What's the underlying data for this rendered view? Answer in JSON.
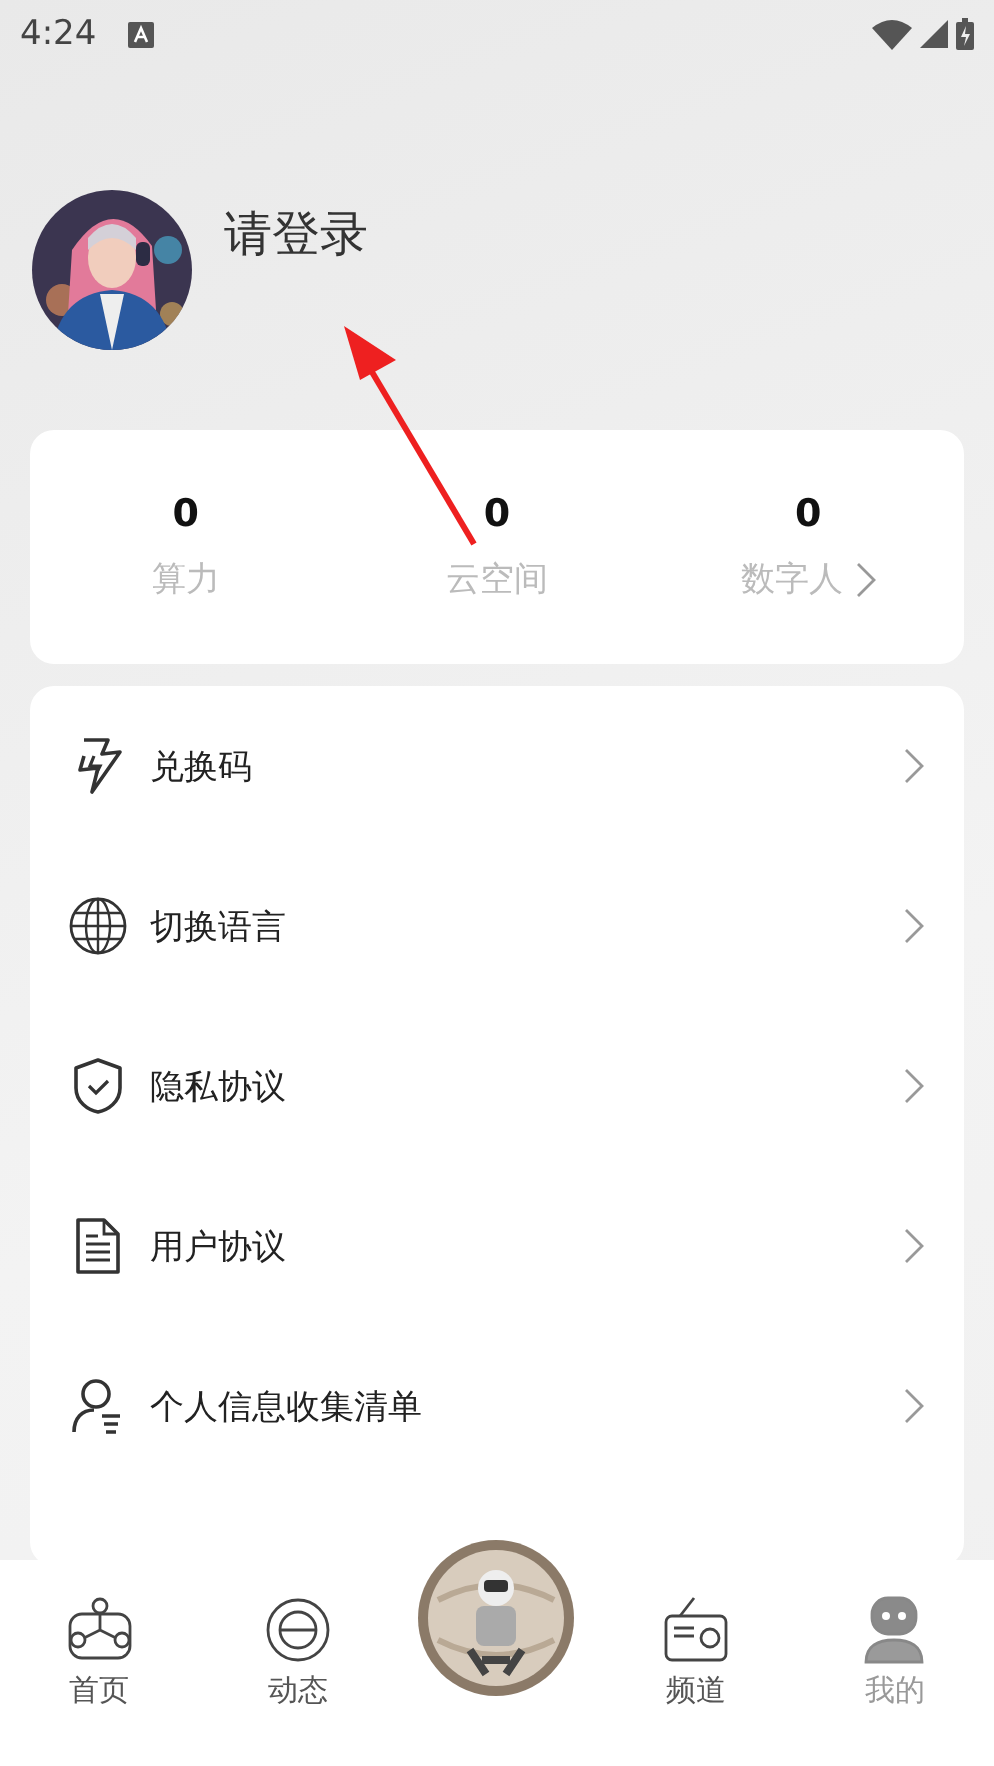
{
  "status_bar": {
    "time": "4:24"
  },
  "profile": {
    "login_prompt": "请登录"
  },
  "stats": [
    {
      "value": "0",
      "label": "算力",
      "has_arrow": false
    },
    {
      "value": "0",
      "label": "云空间",
      "has_arrow": false
    },
    {
      "value": "0",
      "label": "数字人",
      "has_arrow": true
    }
  ],
  "menu": [
    {
      "kind": "bolt",
      "label": "兑换码"
    },
    {
      "kind": "globe",
      "label": "切换语言"
    },
    {
      "kind": "shield",
      "label": "隐私协议"
    },
    {
      "kind": "document",
      "label": "用户协议"
    },
    {
      "kind": "person",
      "label": "个人信息收集清单"
    }
  ],
  "nav": [
    {
      "kind": "home",
      "label": "首页",
      "selected": false
    },
    {
      "kind": "planet",
      "label": "动态",
      "selected": false
    },
    {
      "kind": "center"
    },
    {
      "kind": "radio",
      "label": "频道",
      "selected": false
    },
    {
      "kind": "me",
      "label": "我的",
      "selected": true
    }
  ]
}
